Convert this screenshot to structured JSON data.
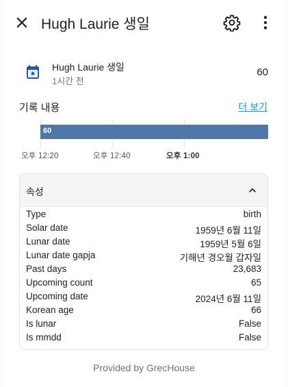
{
  "header": {
    "title": "Hugh Laurie 생일",
    "close_icon": "close-icon",
    "settings_icon": "gear-icon",
    "more_icon": "more-vert-icon"
  },
  "entity": {
    "icon": "calendar-star-icon",
    "icon_color": "#1a5ea8",
    "name": "Hugh Laurie 생일",
    "last_changed": "1시간 전",
    "state": "60"
  },
  "history": {
    "title": "기록 내용",
    "more_link": "더 보기",
    "bar_value": "60",
    "bar_color": "#4f78a6",
    "ticks": [
      "오후 12:20",
      "오후 12:40",
      "오후 1:00"
    ]
  },
  "attributes": {
    "title": "속성",
    "rows": [
      {
        "key": "Type",
        "value": "birth"
      },
      {
        "key": "Solar date",
        "value": "1959년 6월 11일"
      },
      {
        "key": "Lunar date",
        "value": "1959년 5월 6일"
      },
      {
        "key": "Lunar date gapja",
        "value": "기해년 경오월 갑자일"
      },
      {
        "key": "Past days",
        "value": "23,683"
      },
      {
        "key": "Upcoming count",
        "value": "65"
      },
      {
        "key": "Upcoming date",
        "value": "2024년 6월 11일"
      },
      {
        "key": "Korean age",
        "value": "66"
      },
      {
        "key": "Is lunar",
        "value": "False"
      },
      {
        "key": "Is mmdd",
        "value": "False"
      }
    ]
  },
  "footer": {
    "text": "Provided by GrecHouse"
  }
}
